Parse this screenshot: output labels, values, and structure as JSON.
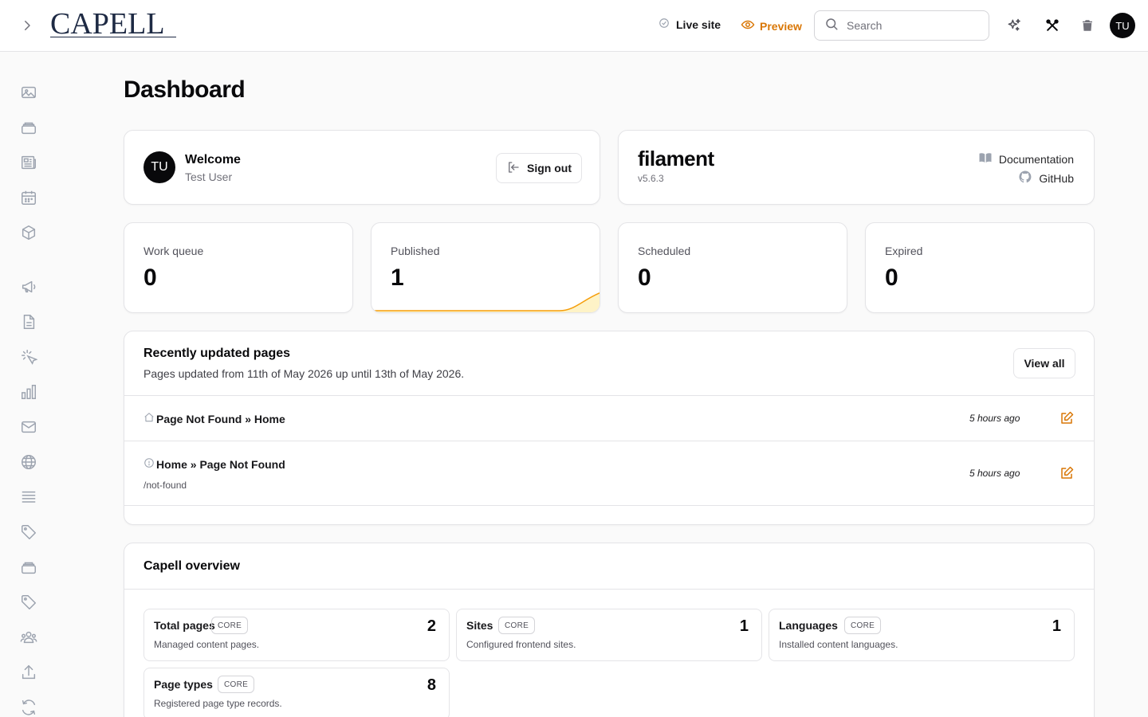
{
  "brand": {
    "logo_text": "CAPELL"
  },
  "topbar": {
    "live_site": "Live site",
    "preview": "Preview",
    "search_placeholder": "Search",
    "user_initials": "TU",
    "accent": "#d97706"
  },
  "sidebar": {
    "items": [
      {
        "icon": "image-icon"
      },
      {
        "icon": "stack-icon"
      },
      {
        "icon": "newspaper-icon"
      },
      {
        "icon": "calendar-icon"
      },
      {
        "icon": "cube-icon"
      },
      {
        "icon": "megaphone-icon"
      },
      {
        "icon": "document-icon"
      },
      {
        "icon": "cursor-click-icon"
      },
      {
        "icon": "bar-chart-icon"
      },
      {
        "icon": "envelope-icon"
      },
      {
        "icon": "globe-icon"
      },
      {
        "icon": "list-icon"
      },
      {
        "icon": "tag-icon"
      },
      {
        "icon": "stack-icon"
      },
      {
        "icon": "tag-icon"
      },
      {
        "icon": "users-icon"
      },
      {
        "icon": "upload-icon"
      },
      {
        "icon": "refresh-icon"
      }
    ]
  },
  "page": {
    "title": "Dashboard"
  },
  "welcome": {
    "initials": "TU",
    "title": "Welcome",
    "user": "Test User",
    "sign_out": "Sign out"
  },
  "filament": {
    "logo": "filament",
    "version": "v5.6.3",
    "docs": "Documentation",
    "github": "GitHub"
  },
  "stats": [
    {
      "label": "Work queue",
      "value": "0"
    },
    {
      "label": "Published",
      "value": "1"
    },
    {
      "label": "Scheduled",
      "value": "0"
    },
    {
      "label": "Expired",
      "value": "0"
    }
  ],
  "recent": {
    "title": "Recently updated pages",
    "description": "Pages updated from 11th of May 2026 up until 13th of May 2026.",
    "view_all": "View all",
    "rows": [
      {
        "icon": "home-icon",
        "title": "Page Not Found » Home",
        "slug": "",
        "time": "5 hours ago"
      },
      {
        "icon": "info-circle-icon",
        "title": "Home » Page Not Found",
        "slug": "/not-found",
        "time": "5 hours ago"
      }
    ]
  },
  "overview": {
    "title": "Capell overview",
    "items": [
      {
        "name": "Total pages",
        "badge": "CORE",
        "description": "Managed content pages.",
        "count": "2"
      },
      {
        "name": "Sites",
        "badge": "CORE",
        "description": "Configured frontend sites.",
        "count": "1"
      },
      {
        "name": "Languages",
        "badge": "CORE",
        "description": "Installed content languages.",
        "count": "1"
      },
      {
        "name": "Page types",
        "badge": "CORE",
        "description": "Registered page type records.",
        "count": "8"
      }
    ]
  }
}
